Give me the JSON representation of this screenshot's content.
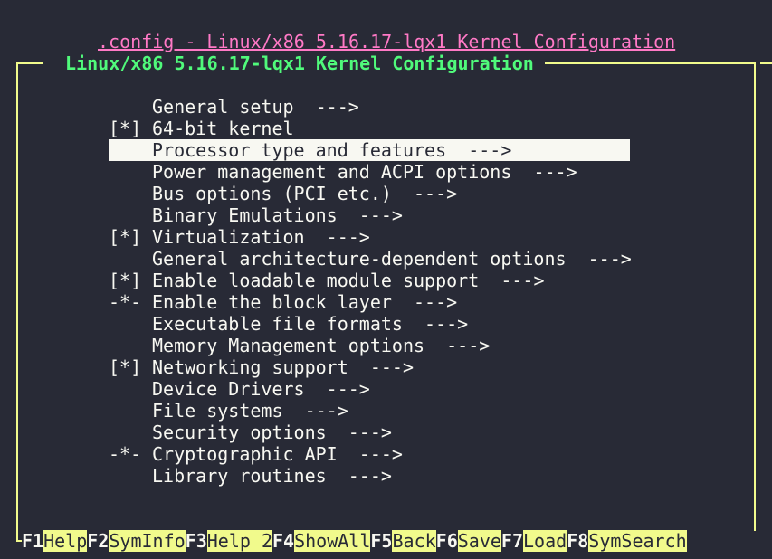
{
  "window": {
    "backtitle": ".config - Linux/x86 5.16.17-lqx1 Kernel Configuration",
    "frame_title": " Linux/x86 5.16.17-lqx1 Kernel Configuration "
  },
  "colors": {
    "background": "#282a36",
    "foreground": "#f8f8f2",
    "backtitle": "#ff79c6",
    "frame_title": "#50fa7b",
    "frame_border": "#f1fa8c",
    "highlight_bg": "#f8f8f2",
    "fkey_bg": "#f1fa8c"
  },
  "menu": {
    "selected_index": 2,
    "items": [
      {
        "prefix": "    ",
        "label": "General setup",
        "arrow": "  --->"
      },
      {
        "prefix": "[*] ",
        "label": "64-bit kernel",
        "arrow": ""
      },
      {
        "prefix": "    ",
        "label": "Processor type and features",
        "arrow": "  --->"
      },
      {
        "prefix": "    ",
        "label": "Power management and ACPI options",
        "arrow": "  --->"
      },
      {
        "prefix": "    ",
        "label": "Bus options (PCI etc.)",
        "arrow": "  --->"
      },
      {
        "prefix": "    ",
        "label": "Binary Emulations",
        "arrow": "  --->"
      },
      {
        "prefix": "[*] ",
        "label": "Virtualization",
        "arrow": "  --->"
      },
      {
        "prefix": "    ",
        "label": "General architecture-dependent options",
        "arrow": "  --->"
      },
      {
        "prefix": "[*] ",
        "label": "Enable loadable module support",
        "arrow": "  --->"
      },
      {
        "prefix": "-*- ",
        "label": "Enable the block layer",
        "arrow": "  --->"
      },
      {
        "prefix": "    ",
        "label": "Executable file formats",
        "arrow": "  --->"
      },
      {
        "prefix": "    ",
        "label": "Memory Management options",
        "arrow": "  --->"
      },
      {
        "prefix": "[*] ",
        "label": "Networking support",
        "arrow": "  --->"
      },
      {
        "prefix": "    ",
        "label": "Device Drivers",
        "arrow": "  --->"
      },
      {
        "prefix": "    ",
        "label": "File systems",
        "arrow": "  --->"
      },
      {
        "prefix": "    ",
        "label": "Security options",
        "arrow": "  --->"
      },
      {
        "prefix": "-*- ",
        "label": "Cryptographic API",
        "arrow": "  --->"
      },
      {
        "prefix": "    ",
        "label": "Library routines",
        "arrow": "  --->"
      }
    ]
  },
  "function_keys": [
    {
      "key": "F1",
      "label": "Help"
    },
    {
      "key": "F2",
      "label": "SymInfo"
    },
    {
      "key": "F3",
      "label": "Help 2"
    },
    {
      "key": "F4",
      "label": "ShowAll"
    },
    {
      "key": "F5",
      "label": "Back"
    },
    {
      "key": "F6",
      "label": "Save"
    },
    {
      "key": "F7",
      "label": "Load"
    },
    {
      "key": "F8",
      "label": "SymSearch"
    }
  ]
}
